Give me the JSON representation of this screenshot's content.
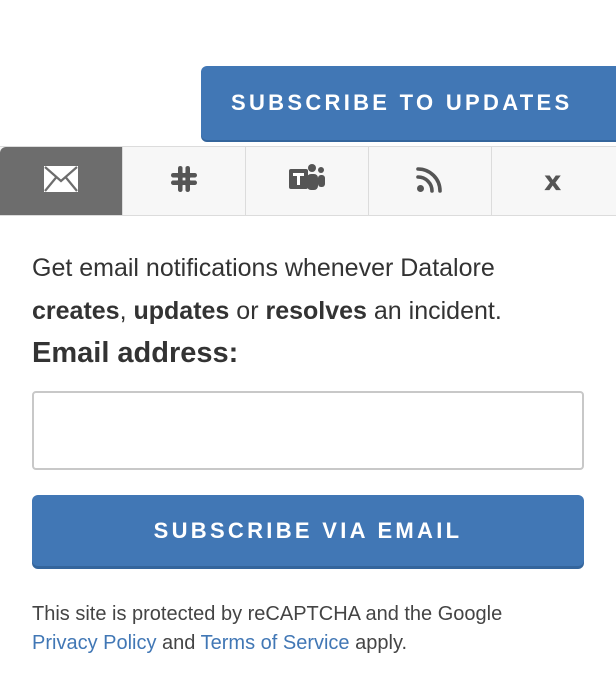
{
  "header": {
    "subscribe_label": "SUBSCRIBE TO UPDATES"
  },
  "tabs": [
    {
      "name": "email",
      "icon": "envelope-icon",
      "active": true
    },
    {
      "name": "slack",
      "icon": "slack-icon",
      "active": false
    },
    {
      "name": "teams",
      "icon": "microsoft-teams-icon",
      "active": false
    },
    {
      "name": "rss",
      "icon": "rss-icon",
      "active": false
    },
    {
      "name": "close",
      "label": "x",
      "active": false
    }
  ],
  "email_panel": {
    "intro_prefix": "Get email notifications whenever Datalore",
    "word_creates": "creates",
    "sep_comma": ",",
    "word_updates": "updates",
    "sep_or": "or",
    "word_resolves": "resolves",
    "intro_suffix": "an incident.",
    "email_label": "Email address:",
    "email_value": "",
    "email_placeholder": "",
    "submit_label": "SUBSCRIBE VIA EMAIL"
  },
  "footer": {
    "recaptcha_text": "This site is protected by reCAPTCHA and the Google",
    "privacy_link": "Privacy Policy",
    "and_text": "and",
    "terms_link": "Terms of Service",
    "apply_text": "apply."
  },
  "colors": {
    "accent": "#4177b5",
    "active_tab": "#6d6d6d",
    "text": "#333333"
  }
}
